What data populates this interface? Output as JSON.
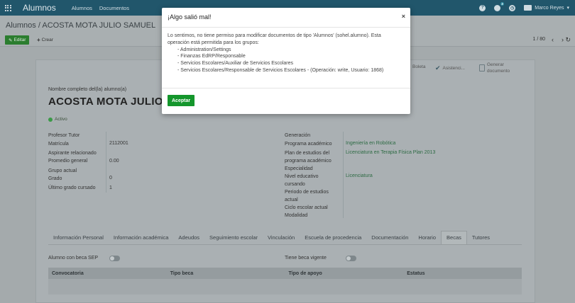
{
  "navbar": {
    "app_title": "Alumnos",
    "menus": [
      "Alumnos",
      "Documentos"
    ],
    "chat_badge": "3",
    "user_name": "Marco Reyes"
  },
  "breadcrumb": "Alumnos / ACOSTA MOTA JULIO SAMUEL",
  "control": {
    "edit_label": "Editar",
    "create_label": "Crear",
    "pager": "1 / 80"
  },
  "sheet": {
    "buttons": [
      "Boleta",
      "Asistenci...",
      "Generar documento"
    ],
    "name_label": "Nombre completo del(la) alumno(a)",
    "name": "ACOSTA MOTA JULIO SA",
    "status": "Activo",
    "left_fields": [
      {
        "label": "Profesor Tutor",
        "value": ""
      },
      {
        "label": "Matrícula",
        "value": "2112001"
      },
      {
        "label": "Aspirante relacionado",
        "value": ""
      },
      {
        "label": "Promedio general",
        "value": "0.00"
      },
      {
        "label": "Grupo actual",
        "value": ""
      },
      {
        "label": "Grado",
        "value": "0"
      },
      {
        "label": "Último grado cursado",
        "value": "1"
      }
    ],
    "right_fields": {
      "generacion": "Generación",
      "programa_label": "Programa académico",
      "programa_value": "Ingeniería en Robótica",
      "plan_label_1": "Plan de estudios del",
      "plan_label_2": "programa académico",
      "plan_value": "Licenciatura en Terapia Física Plan 2013",
      "especialidad": "Especialidad",
      "nivel_label_1": "Nivel educativo",
      "nivel_label_2": "cursando",
      "nivel_value": "Licenciatura",
      "periodo_label_1": "Periodo de estudios",
      "periodo_label_2": "actual",
      "ciclo_label": "Ciclo escolar actual",
      "modalidad": "Modalidad"
    },
    "tabs": [
      "Información Personal",
      "Información académica",
      "Adeudos",
      "Seguimiento escolar",
      "Vinculación",
      "Escuela de procedencia",
      "Documentación",
      "Horario",
      "Becas",
      "Tutores"
    ],
    "active_tab": "Becas",
    "beca_sep_label": "Alumno con beca SEP",
    "beca_vigente_label": "Tiene beca vigente",
    "table_headers": [
      "Convocatoria",
      "Tipo beca",
      "Tipo de apoyo",
      "Estatus"
    ]
  },
  "modal": {
    "title": "¡Algo salió mal!",
    "close": "×",
    "message": "Lo sentimos, no tiene permiso para modificar documentos de tipo 'Alumnos' (sohel.alumno). Esta operación está permitida para los grupos:",
    "groups": [
      "- Administration/Settings",
      "- Finanzas EdRP/Responsable",
      "- Servicios Escolares/Auxiliar de Servicios Escolares",
      "- Servicios Escolares/Responsable de Servicios Escolares - (Operación: write, Usuario: 1868)"
    ],
    "ok_label": "Aceptar"
  },
  "colors": {
    "navbar": "#21566b",
    "primary_button": "#14962c",
    "link": "#2e6b44"
  }
}
